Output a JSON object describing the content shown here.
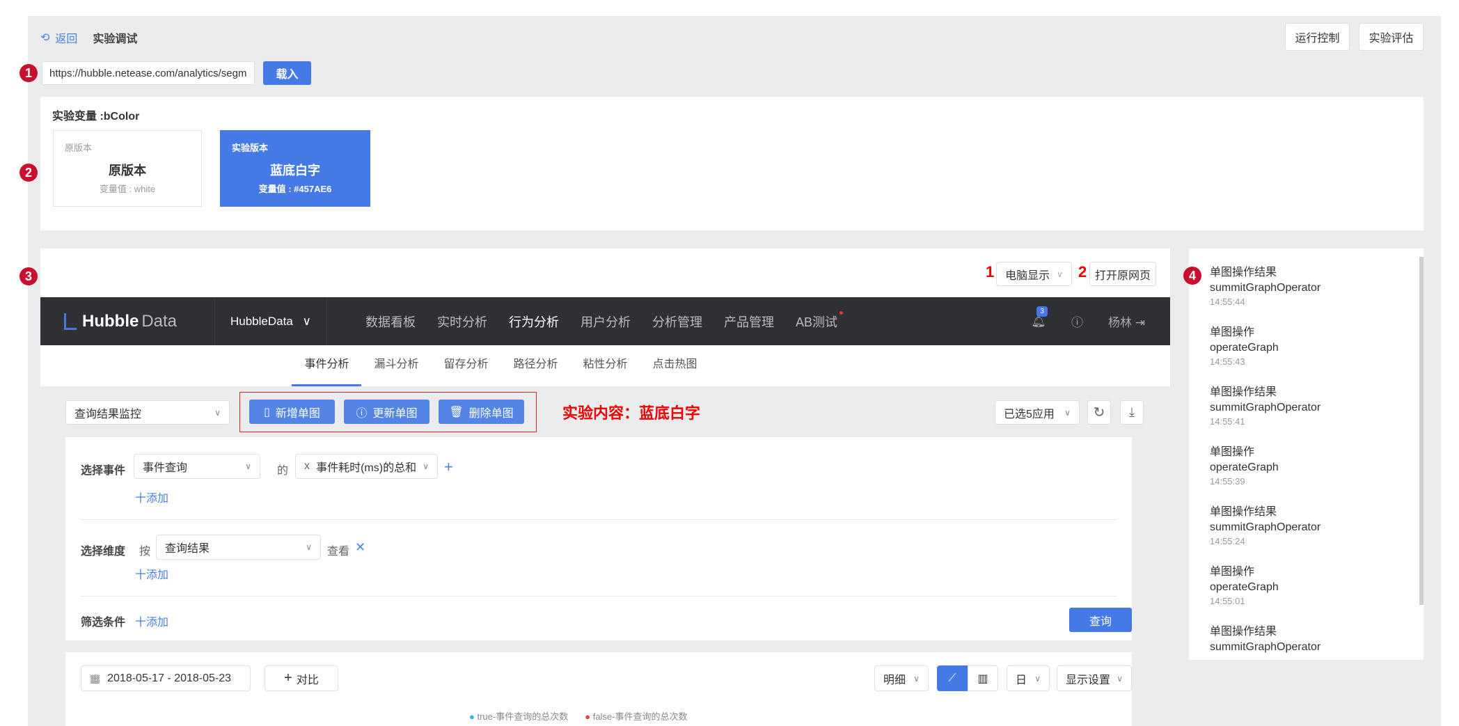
{
  "header": {
    "back": "返回",
    "title": "实验调试",
    "run_control": "运行控制",
    "evaluate": "实验评估"
  },
  "url": {
    "value": "https://hubble.netease.com/analytics/segmentation",
    "load": "载入"
  },
  "badges": [
    "1",
    "2",
    "3",
    "4"
  ],
  "variable": {
    "title": "实验变量 :bColor",
    "original": {
      "tag": "原版本",
      "name": "原版本",
      "value": "变量值 : white"
    },
    "experiment": {
      "tag": "实验版本",
      "name": "蓝底白字",
      "value": "变量值 : #457AE6",
      "color": "#457AE6"
    }
  },
  "preview": {
    "marker1": "1",
    "display": "电脑显示",
    "marker2": "2",
    "open_page": "打开原网页"
  },
  "app": {
    "logo_a": "Hubble",
    "logo_b": "Data",
    "project": "HubbleData",
    "nav": [
      "数据看板",
      "实时分析",
      "行为分析",
      "用户分析",
      "分析管理",
      "产品管理",
      "AB测试"
    ],
    "active_nav": "行为分析",
    "notify_count": "3",
    "user": "杨林",
    "subtabs": [
      "事件分析",
      "漏斗分析",
      "留存分析",
      "路径分析",
      "粘性分析",
      "点击热图"
    ],
    "monitor": "查询结果监控",
    "add_chart": "新增单图",
    "update_chart": "更新单图",
    "delete_chart": "删除单图",
    "experiment_note": "实验内容：蓝底白字",
    "apps_selected": "已选5应用",
    "form": {
      "event_label": "选择事件",
      "event": "事件查询",
      "of": "的",
      "x": "x",
      "metric": "事件耗时(ms)的总和",
      "add": "十添加",
      "dim_label": "选择维度",
      "by": "按",
      "dim": "查询结果",
      "view": "查看",
      "filter_label": "筛选条件",
      "query": "查询"
    },
    "chart": {
      "date_range": "2018-05-17 - 2018-05-23",
      "compare": "对比",
      "detail": "明细",
      "granularity": "日",
      "display_settings": "显示设置",
      "legend": [
        {
          "name": "true-事件查询的总次数",
          "color": "#3ab0e2"
        },
        {
          "name": "false-事件查询的总次数",
          "color": "#d9463e"
        }
      ]
    }
  },
  "logs": [
    {
      "title": "单图操作结果",
      "name": "summitGraphOperator",
      "time": "14:55:44"
    },
    {
      "title": "单图操作",
      "name": "operateGraph",
      "time": "14:55:43"
    },
    {
      "title": "单图操作结果",
      "name": "summitGraphOperator",
      "time": "14:55:41"
    },
    {
      "title": "单图操作",
      "name": "operateGraph",
      "time": "14:55:39"
    },
    {
      "title": "单图操作结果",
      "name": "summitGraphOperator",
      "time": "14:55:24"
    },
    {
      "title": "单图操作",
      "name": "operateGraph",
      "time": "14:55:01"
    },
    {
      "title": "单图操作结果",
      "name": "summitGraphOperator",
      "time": ""
    }
  ]
}
